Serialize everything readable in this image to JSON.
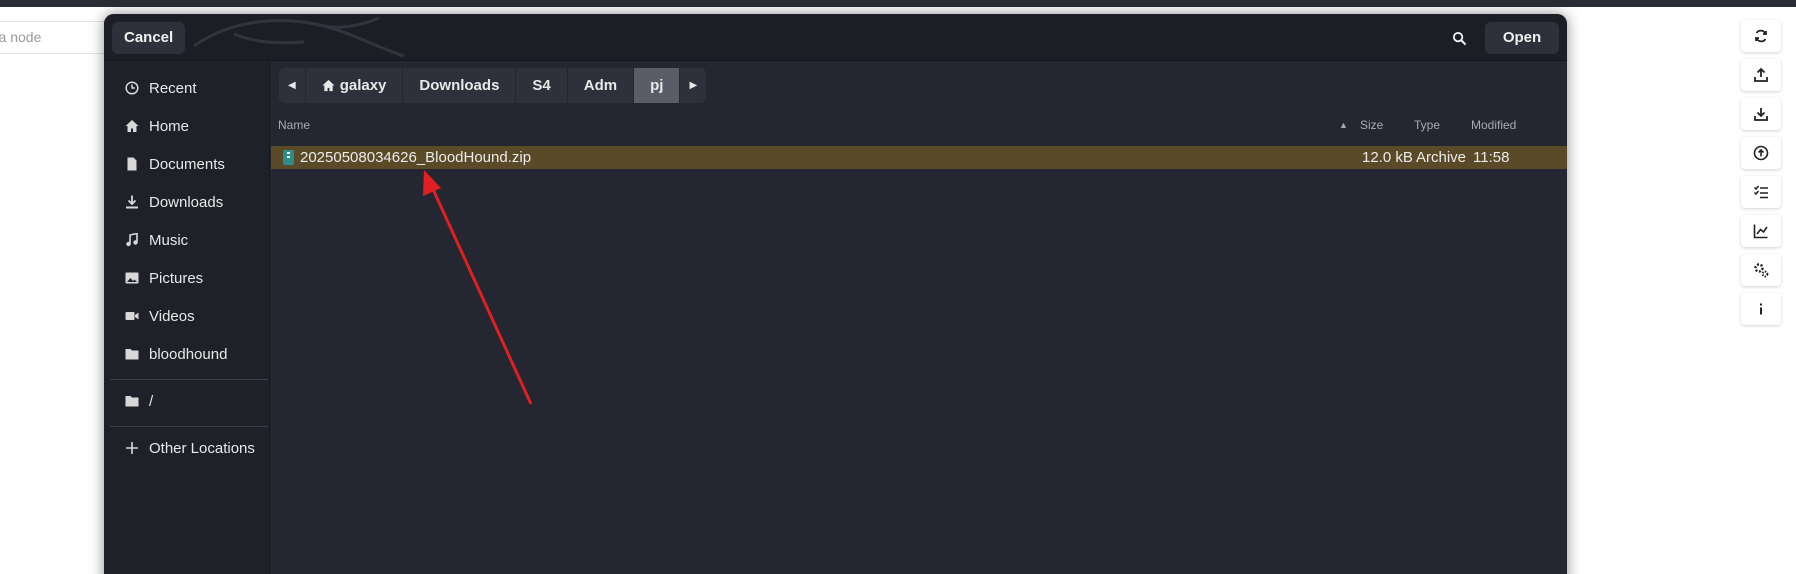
{
  "background_app": {
    "search_placeholder": "r a node",
    "toolbar_icons": [
      "refresh-icon",
      "upload-icon",
      "download-icon",
      "upload-circle-icon",
      "checklist-icon",
      "chart-icon",
      "settings-icon",
      "info-icon"
    ]
  },
  "dialog": {
    "cancel_label": "Cancel",
    "open_label": "Open",
    "sidebar": {
      "items": [
        {
          "label": "Recent",
          "icon": "clock-icon"
        },
        {
          "label": "Home",
          "icon": "home-icon"
        },
        {
          "label": "Documents",
          "icon": "document-icon"
        },
        {
          "label": "Downloads",
          "icon": "download-icon"
        },
        {
          "label": "Music",
          "icon": "music-icon"
        },
        {
          "label": "Pictures",
          "icon": "picture-icon"
        },
        {
          "label": "Videos",
          "icon": "video-icon"
        },
        {
          "label": "bloodhound",
          "icon": "folder-icon"
        }
      ],
      "root_label": "/",
      "other_locations_label": "Other Locations"
    },
    "pathbar": {
      "crumbs": [
        "galaxy",
        "Downloads",
        "S4",
        "Adm",
        "pj"
      ],
      "active": "pj"
    },
    "columns": {
      "name": "Name",
      "size": "Size",
      "type": "Type",
      "modified": "Modified"
    },
    "files": [
      {
        "name": "20250508034626_BloodHound.zip",
        "size": "12.0 kB",
        "type": "Archive",
        "modified": "11:58"
      }
    ]
  },
  "colors": {
    "dialog_bg": "#242731",
    "selected_row": "#5a4a28",
    "annotation_arrow": "#e02020"
  }
}
